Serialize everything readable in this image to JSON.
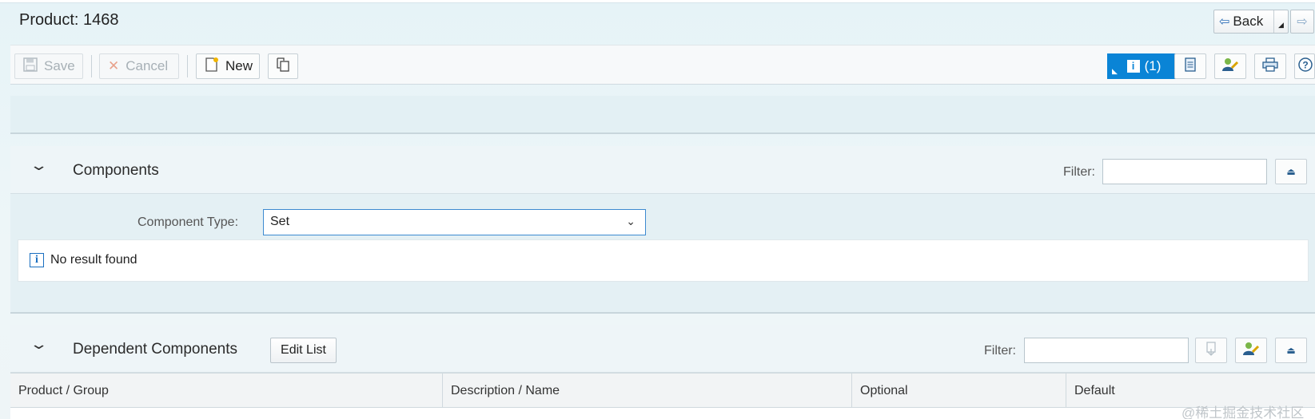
{
  "header": {
    "title": "Product: 1468",
    "back_label": "Back"
  },
  "toolbar": {
    "save_label": "Save",
    "cancel_label": "Cancel",
    "new_label": "New",
    "messages_label": "(1)"
  },
  "components": {
    "title": "Components",
    "filter_label": "Filter:",
    "component_type_label": "Component Type:",
    "component_type_value": "Set",
    "result_message": "No result found"
  },
  "dependent_components": {
    "title": "Dependent Components",
    "edit_list_label": "Edit List",
    "filter_label": "Filter:",
    "columns": [
      "Product / Group",
      "Description / Name",
      "Optional",
      "Default"
    ]
  },
  "watermark": "@稀土掘金技术社区",
  "icons": {
    "back": "arrow-left-icon",
    "forward": "arrow-right-icon",
    "save": "floppy-disk-icon",
    "cancel": "x-icon",
    "new": "new-document-icon",
    "copy": "copy-document-icon",
    "messages": "info-icon",
    "notes": "notes-icon",
    "user_settings": "user-settings-icon",
    "print": "printer-icon",
    "help": "help-icon",
    "collapse": "collapse-triangle-icon"
  },
  "colors": {
    "accent": "#0a84d6"
  }
}
